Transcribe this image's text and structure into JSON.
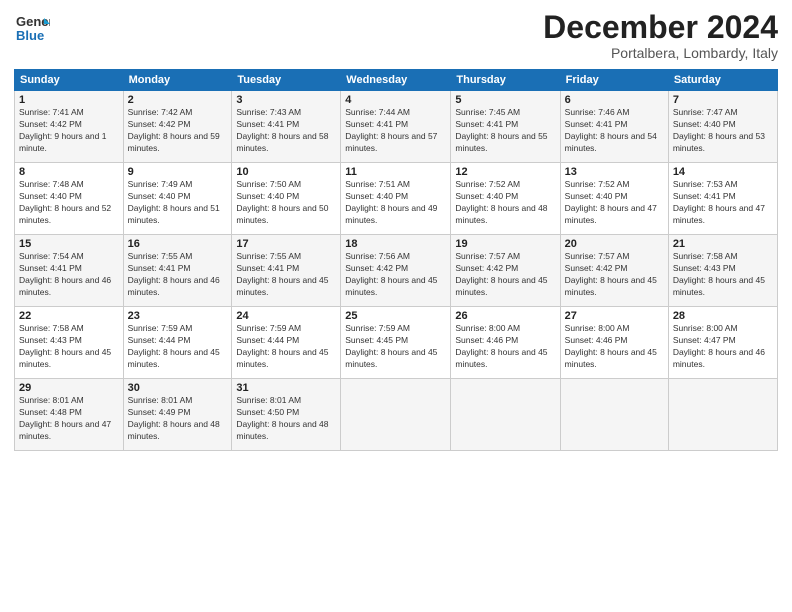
{
  "logo": {
    "line1": "General",
    "line2": "Blue"
  },
  "title": "December 2024",
  "location": "Portalbera, Lombardy, Italy",
  "headers": [
    "Sunday",
    "Monday",
    "Tuesday",
    "Wednesday",
    "Thursday",
    "Friday",
    "Saturday"
  ],
  "weeks": [
    [
      {
        "day": "1",
        "sunrise": "7:41 AM",
        "sunset": "4:42 PM",
        "daylight": "9 hours and 1 minute."
      },
      {
        "day": "2",
        "sunrise": "7:42 AM",
        "sunset": "4:42 PM",
        "daylight": "8 hours and 59 minutes."
      },
      {
        "day": "3",
        "sunrise": "7:43 AM",
        "sunset": "4:41 PM",
        "daylight": "8 hours and 58 minutes."
      },
      {
        "day": "4",
        "sunrise": "7:44 AM",
        "sunset": "4:41 PM",
        "daylight": "8 hours and 57 minutes."
      },
      {
        "day": "5",
        "sunrise": "7:45 AM",
        "sunset": "4:41 PM",
        "daylight": "8 hours and 55 minutes."
      },
      {
        "day": "6",
        "sunrise": "7:46 AM",
        "sunset": "4:41 PM",
        "daylight": "8 hours and 54 minutes."
      },
      {
        "day": "7",
        "sunrise": "7:47 AM",
        "sunset": "4:40 PM",
        "daylight": "8 hours and 53 minutes."
      }
    ],
    [
      {
        "day": "8",
        "sunrise": "7:48 AM",
        "sunset": "4:40 PM",
        "daylight": "8 hours and 52 minutes."
      },
      {
        "day": "9",
        "sunrise": "7:49 AM",
        "sunset": "4:40 PM",
        "daylight": "8 hours and 51 minutes."
      },
      {
        "day": "10",
        "sunrise": "7:50 AM",
        "sunset": "4:40 PM",
        "daylight": "8 hours and 50 minutes."
      },
      {
        "day": "11",
        "sunrise": "7:51 AM",
        "sunset": "4:40 PM",
        "daylight": "8 hours and 49 minutes."
      },
      {
        "day": "12",
        "sunrise": "7:52 AM",
        "sunset": "4:40 PM",
        "daylight": "8 hours and 48 minutes."
      },
      {
        "day": "13",
        "sunrise": "7:52 AM",
        "sunset": "4:40 PM",
        "daylight": "8 hours and 47 minutes."
      },
      {
        "day": "14",
        "sunrise": "7:53 AM",
        "sunset": "4:41 PM",
        "daylight": "8 hours and 47 minutes."
      }
    ],
    [
      {
        "day": "15",
        "sunrise": "7:54 AM",
        "sunset": "4:41 PM",
        "daylight": "8 hours and 46 minutes."
      },
      {
        "day": "16",
        "sunrise": "7:55 AM",
        "sunset": "4:41 PM",
        "daylight": "8 hours and 46 minutes."
      },
      {
        "day": "17",
        "sunrise": "7:55 AM",
        "sunset": "4:41 PM",
        "daylight": "8 hours and 45 minutes."
      },
      {
        "day": "18",
        "sunrise": "7:56 AM",
        "sunset": "4:42 PM",
        "daylight": "8 hours and 45 minutes."
      },
      {
        "day": "19",
        "sunrise": "7:57 AM",
        "sunset": "4:42 PM",
        "daylight": "8 hours and 45 minutes."
      },
      {
        "day": "20",
        "sunrise": "7:57 AM",
        "sunset": "4:42 PM",
        "daylight": "8 hours and 45 minutes."
      },
      {
        "day": "21",
        "sunrise": "7:58 AM",
        "sunset": "4:43 PM",
        "daylight": "8 hours and 45 minutes."
      }
    ],
    [
      {
        "day": "22",
        "sunrise": "7:58 AM",
        "sunset": "4:43 PM",
        "daylight": "8 hours and 45 minutes."
      },
      {
        "day": "23",
        "sunrise": "7:59 AM",
        "sunset": "4:44 PM",
        "daylight": "8 hours and 45 minutes."
      },
      {
        "day": "24",
        "sunrise": "7:59 AM",
        "sunset": "4:44 PM",
        "daylight": "8 hours and 45 minutes."
      },
      {
        "day": "25",
        "sunrise": "7:59 AM",
        "sunset": "4:45 PM",
        "daylight": "8 hours and 45 minutes."
      },
      {
        "day": "26",
        "sunrise": "8:00 AM",
        "sunset": "4:46 PM",
        "daylight": "8 hours and 45 minutes."
      },
      {
        "day": "27",
        "sunrise": "8:00 AM",
        "sunset": "4:46 PM",
        "daylight": "8 hours and 45 minutes."
      },
      {
        "day": "28",
        "sunrise": "8:00 AM",
        "sunset": "4:47 PM",
        "daylight": "8 hours and 46 minutes."
      }
    ],
    [
      {
        "day": "29",
        "sunrise": "8:01 AM",
        "sunset": "4:48 PM",
        "daylight": "8 hours and 47 minutes."
      },
      {
        "day": "30",
        "sunrise": "8:01 AM",
        "sunset": "4:49 PM",
        "daylight": "8 hours and 48 minutes."
      },
      {
        "day": "31",
        "sunrise": "8:01 AM",
        "sunset": "4:50 PM",
        "daylight": "8 hours and 48 minutes."
      },
      null,
      null,
      null,
      null
    ]
  ],
  "labels": {
    "sunrise": "Sunrise:",
    "sunset": "Sunset:",
    "daylight": "Daylight:"
  }
}
